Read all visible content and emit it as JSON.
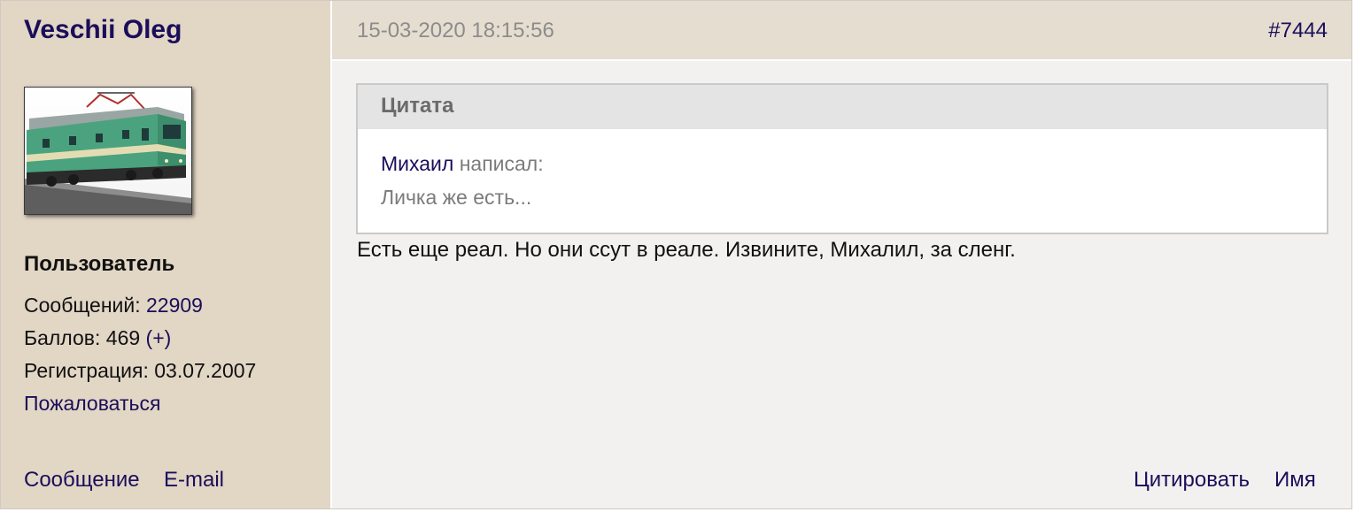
{
  "user": {
    "name": "Veschii Oleg",
    "role": "Пользователь",
    "messages_label": "Сообщений:",
    "messages_count": "22909",
    "points_label": "Баллов: 469",
    "points_plus": "(+)",
    "registration": "Регистрация: 03.07.2007",
    "report_link": "Пожаловаться",
    "message_link": "Сообщение",
    "email_link": "E-mail"
  },
  "post": {
    "datetime": "15-03-2020 18:15:56",
    "number": "#7444",
    "quote": {
      "header": "Цитата",
      "author": "Михаил",
      "wrote": "написал:",
      "text": "Личка же есть..."
    },
    "body": "Есть еще реал. Но они ссут в реале. Извините, Михалил, за сленг.",
    "quote_button": "Цитировать",
    "name_button": "Имя"
  },
  "colors": {
    "link": "#1a0e5a",
    "sidebar_bg": "#e2d6c5",
    "header_bg": "#e5ddd0",
    "content_bg": "#f2f1ef"
  },
  "icons": {
    "avatar": "electric-locomotive-image"
  }
}
